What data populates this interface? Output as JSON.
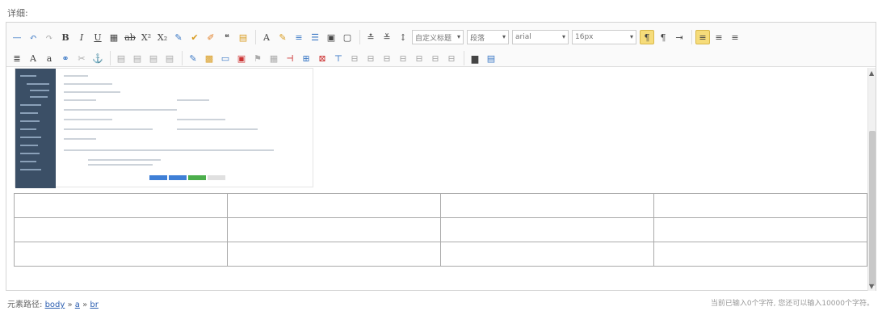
{
  "field_label": "详细:",
  "toolbar": {
    "font_family": "arial",
    "font_size": "16px",
    "paragraph_style": "段落",
    "custom_title": "自定义标题"
  },
  "statusbar": {
    "path_label": "元素路径:",
    "path_items": [
      "body",
      "a",
      "br"
    ],
    "path_sep": " » ",
    "char_count": "当前已输入0个字符, 您还可以输入10000个字符。"
  },
  "colors": {
    "accent": "#3b78c5",
    "active": "#f6dc7a",
    "sidebar": "#3b4f66"
  },
  "table": {
    "rows": 3,
    "cols": 4
  }
}
